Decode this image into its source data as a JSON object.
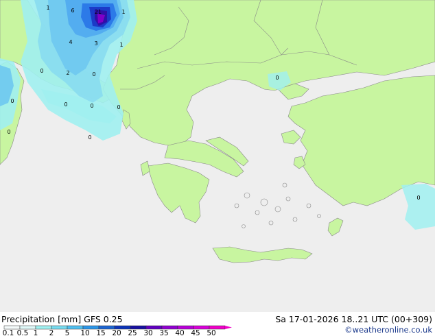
{
  "map": {
    "region": "Greece / Aegean",
    "land_color": "#c8f5a0",
    "sea_color": "#eeeeee",
    "border_color": "#888888",
    "precip_colors": [
      "#a0f0f0",
      "#88dcf0",
      "#6ec8f0",
      "#50aaf0",
      "#2c7ae8",
      "#1c3ac8",
      "#3010a8",
      "#8000c8"
    ],
    "values": [
      "6",
      "21",
      "1",
      "1",
      "4",
      "3",
      "1",
      "2",
      "0",
      "0",
      "0",
      "0",
      "0",
      "0",
      "0",
      "0",
      "0",
      "0"
    ]
  },
  "footer": {
    "title": "Precipitation [mm]  GFS 0.25",
    "datetime": "Sa 17-01-2026 18..21 UTC (00+309)",
    "credit": "©weatheronline.co.uk"
  },
  "legend": {
    "labels": [
      "0.1",
      "0.5",
      "1",
      "2",
      "5",
      "10",
      "15",
      "20",
      "25",
      "30",
      "35",
      "40",
      "45",
      "50"
    ],
    "colors": [
      "#f4fafa",
      "#e0f8f8",
      "#a0f0f0",
      "#78dcf0",
      "#50c0f0",
      "#2c96e8",
      "#1c64d0",
      "#0c34b8",
      "#1810a0",
      "#6000c0",
      "#9000d0",
      "#b800d8",
      "#d800d8",
      "#f000c8"
    ]
  }
}
